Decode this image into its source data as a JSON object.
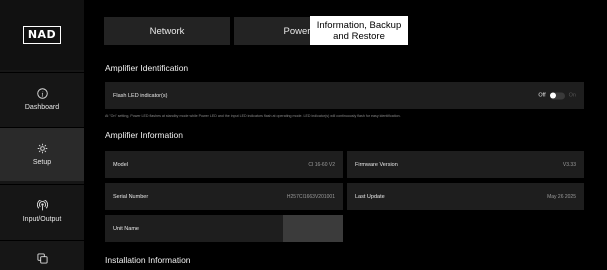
{
  "brand": {
    "logo_text": "NAD"
  },
  "sidebar": {
    "items": [
      {
        "label": "Dashboard",
        "icon": "info-icon"
      },
      {
        "label": "Setup",
        "icon": "gear-icon"
      },
      {
        "label": "Input/Output",
        "icon": "broadcast-icon"
      },
      {
        "label": "",
        "icon": "copy-icon"
      }
    ]
  },
  "tabs": [
    {
      "label": "Network",
      "active": false
    },
    {
      "label": "Power",
      "active": false
    },
    {
      "label": "Information, Backup and Restore",
      "active": true
    }
  ],
  "amp_identification": {
    "title": "Amplifier Identification",
    "flash_led_label": "Flash LED indicator(s)",
    "toggle_off_label": "Off",
    "toggle_on_label": "On",
    "toggle_state": "off",
    "hint": "At \"On\" setting, Power LED flashes at standby mode while Power LED and the input LED indicators flash at operating mode. LED indicator(s) will continuously flash for easy identification."
  },
  "amp_information": {
    "title": "Amplifier Information",
    "model_label": "Model",
    "model_value": "CI 16-60 V2",
    "firmware_label": "Firmware Version",
    "firmware_value": "V3.33",
    "serial_label": "Serial Number",
    "serial_value": "H257CI1663V201001",
    "last_update_label": "Last Update",
    "last_update_value": "May 26 2025",
    "unit_name_label": "Unit Name",
    "unit_name_value": ""
  },
  "installation": {
    "title": "Installation Information"
  },
  "colors": {
    "background": "#000000",
    "panel": "#1e1e1e",
    "sidebar": "#161616",
    "active_tab": "#ffffff"
  }
}
